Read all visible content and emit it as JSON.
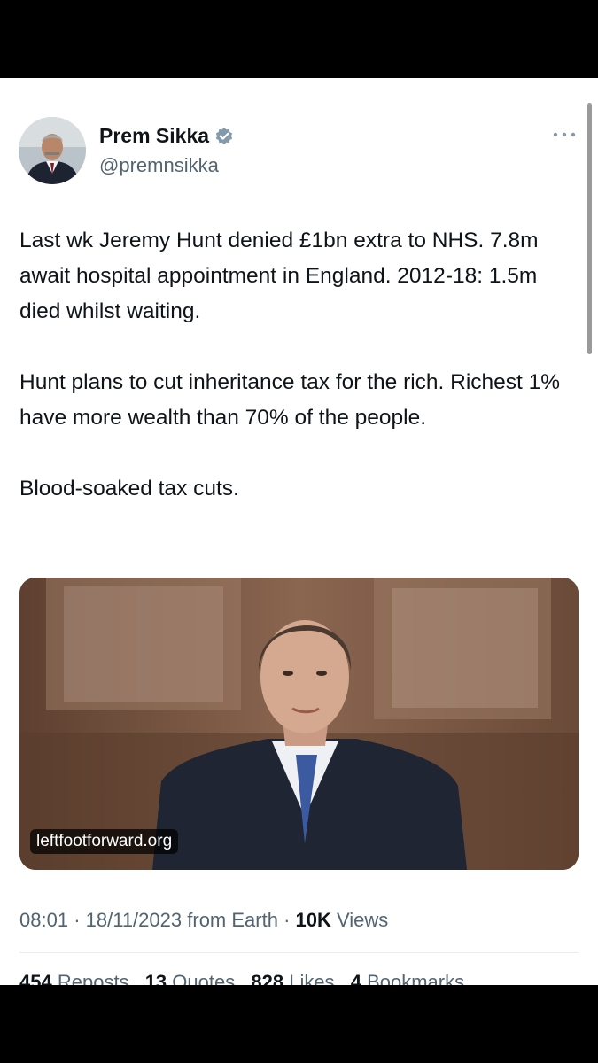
{
  "user": {
    "display_name": "Prem Sikka",
    "handle": "@premnsikka",
    "verified_badge": "verified-badge-icon"
  },
  "tweet": {
    "paragraphs": [
      "Last wk Jeremy Hunt denied £1bn extra to NHS. 7.8m await hospital appointment in England. 2012-18: 1.5m died whilst waiting.",
      "Hunt plans to cut inheritance tax for the rich. Richest 1% have more wealth than 70% of the people.",
      "Blood-soaked tax cuts."
    ],
    "media_watermark": "leftfootforward.org"
  },
  "meta": {
    "time": "08:01",
    "separator": "·",
    "date": "18/11/2023",
    "source": "from Earth",
    "views_count": "10K",
    "views_label": "Views"
  },
  "stats": {
    "reposts_count": "454",
    "reposts_label": "Reposts",
    "quotes_count": "13",
    "quotes_label": "Quotes",
    "likes_count": "828",
    "likes_label": "Likes",
    "bookmarks_count": "4",
    "bookmarks_label": "Bookmarks"
  },
  "colors": {
    "text_primary": "#0f1419",
    "text_secondary": "#536471",
    "verified": "#829aab",
    "background": "#ffffff"
  }
}
